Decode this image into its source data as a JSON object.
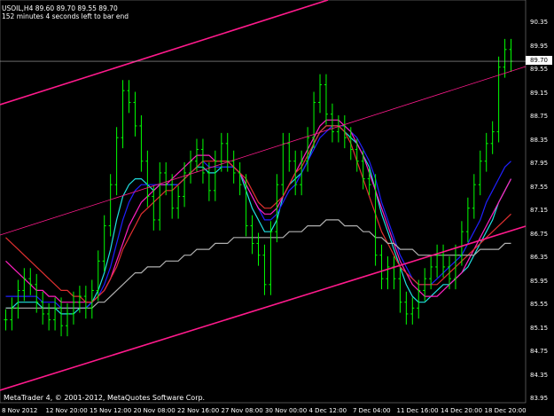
{
  "header": {
    "symbol_line": "USOIL,H4  89.60 89.70 89.55 89.70",
    "timer": "152 minutes 4 seconds left to bar end"
  },
  "footer": {
    "copyright": "MetaTrader 4, © 2001-2012, MetaQuotes Software Corp."
  },
  "colors": {
    "background": "#000000",
    "bull_bar": "#00ff00",
    "channel": "#ff1a8c",
    "ma_cyan": "#20e0e0",
    "ma_blue": "#2020ff",
    "ma_magenta": "#ff20c0",
    "ma_red": "#e03030",
    "ma_gray": "#b0b0b0"
  },
  "current_price_label": "89.70",
  "price_ticks": [
    "90.35",
    "89.95",
    "89.55",
    "89.15",
    "88.75",
    "88.35",
    "87.95",
    "87.55",
    "87.15",
    "86.75",
    "86.35",
    "85.95",
    "85.55",
    "85.15",
    "84.75",
    "84.35",
    "83.95"
  ],
  "date_ticks": [
    "8 Nov 2012",
    "12 Nov 20:00",
    "15 Nov 12:00",
    "20 Nov 08:00",
    "22 Nov 16:00",
    "27 Nov 08:00",
    "30 Nov 00:00",
    "4 Dec 12:00",
    "7 Dec 04:00",
    "11 Dec 16:00",
    "14 Dec 20:00",
    "18 Dec 20:00"
  ],
  "chart_data": {
    "type": "line",
    "symbol": "USOIL",
    "timeframe": "H4",
    "ylim": [
      83.95,
      90.35
    ],
    "last_bar": {
      "open": 89.6,
      "high": 89.7,
      "low": 89.55,
      "close": 89.7
    },
    "series": [
      {
        "name": "price",
        "values": [
          85.3,
          85.5,
          85.8,
          86.0,
          85.9,
          85.6,
          85.4,
          85.3,
          85.5,
          85.2,
          85.4,
          85.6,
          85.7,
          85.5,
          85.8,
          86.3,
          86.9,
          87.6,
          88.4,
          89.2,
          89.0,
          88.6,
          88.0,
          87.4,
          87.0,
          87.8,
          87.6,
          87.2,
          87.4,
          87.8,
          88.0,
          88.2,
          87.8,
          87.5,
          88.0,
          88.3,
          88.0,
          87.8,
          87.6,
          86.9,
          86.6,
          86.4,
          85.9,
          86.8,
          87.6,
          88.3,
          88.0,
          87.6,
          88.0,
          88.4,
          89.0,
          89.3,
          88.8,
          88.5,
          88.6,
          88.4,
          88.2,
          88.0,
          87.7,
          87.6,
          86.4,
          86.0,
          86.2,
          86.0,
          85.6,
          85.4,
          85.5,
          85.8,
          86.0,
          86.2,
          86.4,
          86.2,
          86.0,
          86.4,
          86.8,
          87.2,
          87.6,
          88.0,
          88.3,
          88.5,
          89.6,
          89.9,
          89.7
        ]
      },
      {
        "name": "ma-cyan",
        "values": [
          85.5,
          85.5,
          85.6,
          85.6,
          85.6,
          85.6,
          85.5,
          85.5,
          85.5,
          85.4,
          85.4,
          85.4,
          85.5,
          85.5,
          85.6,
          85.8,
          86.1,
          86.5,
          87.0,
          87.4,
          87.6,
          87.7,
          87.7,
          87.6,
          87.5,
          87.6,
          87.6,
          87.6,
          87.6,
          87.7,
          87.8,
          87.9,
          87.9,
          87.8,
          87.8,
          87.9,
          87.9,
          87.9,
          87.8,
          87.5,
          87.2,
          87.0,
          86.8,
          86.8,
          87.0,
          87.4,
          87.6,
          87.7,
          87.8,
          88.0,
          88.3,
          88.5,
          88.6,
          88.6,
          88.6,
          88.5,
          88.4,
          88.3,
          88.1,
          87.9,
          87.5,
          87.1,
          86.8,
          86.5,
          86.2,
          85.9,
          85.7,
          85.6,
          85.6,
          85.7,
          85.8,
          85.9,
          85.9,
          86.0,
          86.1,
          86.2,
          86.4,
          86.6,
          86.8,
          87.0,
          87.3,
          87.5,
          87.7
        ]
      },
      {
        "name": "ma-blue",
        "values": [
          85.7,
          85.7,
          85.7,
          85.7,
          85.7,
          85.7,
          85.6,
          85.6,
          85.6,
          85.5,
          85.5,
          85.5,
          85.5,
          85.5,
          85.6,
          85.7,
          85.9,
          86.2,
          86.6,
          87.0,
          87.3,
          87.5,
          87.6,
          87.6,
          87.6,
          87.6,
          87.6,
          87.6,
          87.6,
          87.7,
          87.8,
          87.9,
          88.0,
          87.9,
          87.9,
          87.9,
          87.9,
          87.9,
          87.8,
          87.6,
          87.4,
          87.2,
          87.0,
          87.0,
          87.1,
          87.3,
          87.5,
          87.6,
          87.8,
          88.0,
          88.2,
          88.4,
          88.5,
          88.6,
          88.6,
          88.6,
          88.5,
          88.4,
          88.2,
          88.0,
          87.7,
          87.3,
          87.0,
          86.7,
          86.4,
          86.2,
          86.0,
          85.9,
          85.9,
          85.9,
          86.0,
          86.1,
          86.2,
          86.3,
          86.4,
          86.6,
          86.8,
          87.0,
          87.3,
          87.5,
          87.7,
          87.9,
          88.0
        ]
      },
      {
        "name": "ma-magenta",
        "values": [
          86.3,
          86.2,
          86.1,
          86.0,
          85.9,
          85.8,
          85.8,
          85.7,
          85.7,
          85.6,
          85.6,
          85.6,
          85.6,
          85.6,
          85.6,
          85.7,
          85.8,
          86.0,
          86.3,
          86.6,
          86.9,
          87.1,
          87.3,
          87.4,
          87.5,
          87.6,
          87.6,
          87.7,
          87.8,
          87.9,
          88.0,
          88.1,
          88.1,
          88.1,
          88.0,
          88.0,
          88.0,
          87.9,
          87.8,
          87.6,
          87.4,
          87.2,
          87.1,
          87.1,
          87.2,
          87.4,
          87.6,
          87.8,
          88.0,
          88.2,
          88.4,
          88.6,
          88.7,
          88.7,
          88.7,
          88.6,
          88.5,
          88.3,
          88.1,
          87.8,
          87.5,
          87.2,
          86.9,
          86.6,
          86.3,
          86.1,
          85.9,
          85.8,
          85.7,
          85.7,
          85.7,
          85.8,
          85.9,
          86.0,
          86.1,
          86.3,
          86.5,
          86.7,
          86.9,
          87.1,
          87.3,
          87.5,
          87.7
        ]
      },
      {
        "name": "ma-red",
        "values": [
          86.7,
          86.6,
          86.5,
          86.4,
          86.3,
          86.2,
          86.1,
          86.0,
          85.9,
          85.8,
          85.8,
          85.7,
          85.7,
          85.6,
          85.6,
          85.7,
          85.8,
          86.0,
          86.2,
          86.5,
          86.7,
          86.9,
          87.1,
          87.2,
          87.3,
          87.4,
          87.5,
          87.5,
          87.6,
          87.7,
          87.8,
          87.9,
          88.0,
          88.0,
          88.0,
          88.0,
          88.0,
          87.9,
          87.8,
          87.7,
          87.5,
          87.3,
          87.2,
          87.2,
          87.3,
          87.4,
          87.6,
          87.8,
          87.9,
          88.1,
          88.3,
          88.5,
          88.6,
          88.6,
          88.6,
          88.5,
          88.3,
          88.0,
          87.7,
          87.4,
          87.1,
          86.8,
          86.6,
          86.4,
          86.2,
          86.1,
          86.0,
          85.9,
          85.9,
          85.9,
          85.9,
          86.0,
          86.1,
          86.2,
          86.3,
          86.4,
          86.5,
          86.6,
          86.7,
          86.8,
          86.9,
          87.0,
          87.1
        ]
      },
      {
        "name": "ma-gray",
        "values": [
          85.5,
          85.5,
          85.5,
          85.5,
          85.5,
          85.5,
          85.5,
          85.5,
          85.5,
          85.5,
          85.5,
          85.5,
          85.5,
          85.5,
          85.5,
          85.6,
          85.6,
          85.7,
          85.8,
          85.9,
          86.0,
          86.1,
          86.1,
          86.2,
          86.2,
          86.2,
          86.3,
          86.3,
          86.3,
          86.4,
          86.4,
          86.5,
          86.5,
          86.5,
          86.6,
          86.6,
          86.6,
          86.7,
          86.7,
          86.7,
          86.7,
          86.7,
          86.7,
          86.7,
          86.7,
          86.7,
          86.8,
          86.8,
          86.8,
          86.9,
          86.9,
          86.9,
          87.0,
          87.0,
          87.0,
          86.9,
          86.9,
          86.9,
          86.8,
          86.8,
          86.7,
          86.7,
          86.6,
          86.6,
          86.5,
          86.5,
          86.5,
          86.4,
          86.4,
          86.4,
          86.4,
          86.4,
          86.4,
          86.4,
          86.4,
          86.4,
          86.4,
          86.5,
          86.5,
          86.5,
          86.5,
          86.6,
          86.6
        ]
      }
    ]
  }
}
